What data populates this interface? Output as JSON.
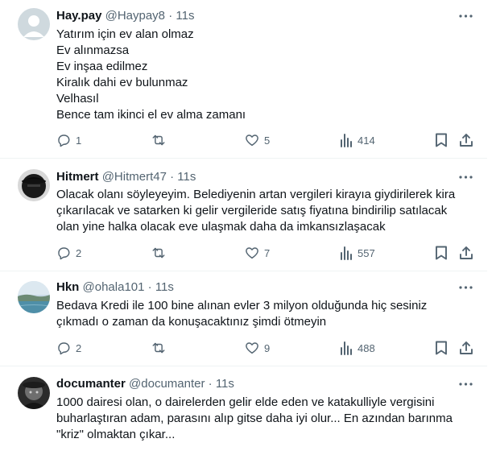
{
  "tweets": [
    {
      "name": "Hay.pay",
      "handle": "@Haypay8",
      "dot": "·",
      "time": "11s",
      "lines": [
        "Yatırım için ev alan olmaz",
        "Ev alınmazsa",
        "Ev inşaa edilmez",
        "Kiralık dahi ev bulunmaz",
        "Velhasıl",
        "Bence tam ikinci el ev alma zamanı"
      ],
      "replies": "1",
      "retweets": "",
      "likes": "5",
      "views": "414"
    },
    {
      "name": "Hitmert",
      "handle": "@Hitmert47",
      "dot": "·",
      "time": "11s",
      "lines": [
        "Olacak olanı söyleyeyim. Belediyenin artan  vergileri kirayıa giydirilerek kira",
        "çıkarılacak ve satarken ki gelir vergileride satış fiyatına bindirilip satılacak",
        "olan yine halka olacak eve ulaşmak daha da imkansızlaşacak"
      ],
      "replies": "2",
      "retweets": "",
      "likes": "7",
      "views": "557"
    },
    {
      "name": "Hkn",
      "handle": "@ohala101",
      "dot": "·",
      "time": "11s",
      "lines": [
        "Bedava Kredi ile 100 bine alınan evler 3 milyon olduğunda hiç sesiniz",
        "çıkmadı o zaman da konuşacaktınız şimdi ötmeyin"
      ],
      "replies": "2",
      "retweets": "",
      "likes": "9",
      "views": "488"
    },
    {
      "name": "documanter",
      "handle": "@documanter",
      "dot": "·",
      "time": "11s",
      "lines": [
        "1000 dairesi olan, o dairelerden gelir elde eden ve katakulliyle vergisini",
        "buharlaştıran adam, parasını alıp gitse daha iyi olur... En azından barınma",
        "\"kriz\" olmaktan çıkar..."
      ],
      "replies": "",
      "retweets": "",
      "likes": "",
      "views": ""
    }
  ],
  "icons": {
    "reply": "reply-icon",
    "retweet": "retweet-icon",
    "like": "heart-icon",
    "views": "views-bar-chart-icon",
    "bookmark": "bookmark-icon",
    "share": "share-icon",
    "more": "more-dots-icon"
  },
  "colors": {
    "text": "#0f1419",
    "secondary": "#536471",
    "separator": "#eff3f4"
  }
}
